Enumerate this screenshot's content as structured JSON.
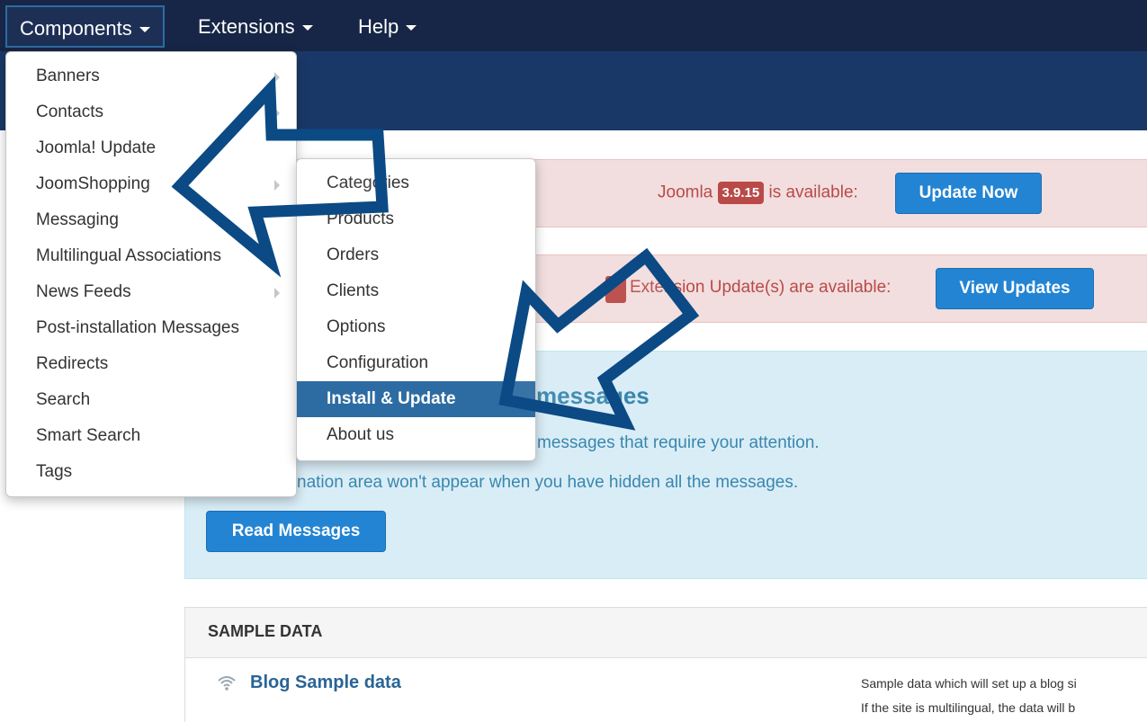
{
  "navbar": {
    "items": [
      {
        "label": "Components"
      },
      {
        "label": "Extensions"
      },
      {
        "label": "Help"
      }
    ]
  },
  "alerts": {
    "joomla_prefix": "Joomla",
    "joomla_version": "3.9.15",
    "joomla_suffix": "is available:",
    "update_now_label": "Update Now",
    "extension_text": "Extension Update(s) are available:",
    "view_updates_label": "View Updates"
  },
  "postinstall": {
    "heading": "messages",
    "line1": "messages that require your attention.",
    "line2": "nation area won't appear when you have hidden all the messages.",
    "read_messages_label": "Read Messages"
  },
  "sample_data": {
    "title": "SAMPLE DATA",
    "blog_label": "Blog Sample data",
    "desc_line1": "Sample data which will set up a blog si",
    "desc_line2": "If the site is multilingual, the data will b"
  },
  "components_menu": {
    "items": [
      {
        "label": "Banners",
        "has_submenu": true
      },
      {
        "label": "Contacts",
        "has_submenu": true
      },
      {
        "label": "Joomla! Update",
        "has_submenu": false
      },
      {
        "label": "JoomShopping",
        "has_submenu": true
      },
      {
        "label": "Messaging",
        "has_submenu": false
      },
      {
        "label": "Multilingual Associations",
        "has_submenu": false
      },
      {
        "label": "News Feeds",
        "has_submenu": true
      },
      {
        "label": "Post-installation Messages",
        "has_submenu": false
      },
      {
        "label": "Redirects",
        "has_submenu": false
      },
      {
        "label": "Search",
        "has_submenu": false
      },
      {
        "label": "Smart Search",
        "has_submenu": false
      },
      {
        "label": "Tags",
        "has_submenu": false
      }
    ]
  },
  "jshop_menu": {
    "items": [
      {
        "label": "Categories"
      },
      {
        "label": "Products"
      },
      {
        "label": "Orders"
      },
      {
        "label": "Clients"
      },
      {
        "label": "Options"
      },
      {
        "label": "Configuration"
      },
      {
        "label": "Install & Update",
        "active": true
      },
      {
        "label": "About us"
      }
    ]
  },
  "colors": {
    "navbar": "#172646",
    "subheader": "#1a3867",
    "accent": "#2d6ca2",
    "button": "#2384d3",
    "alert_bg": "#f2dede",
    "alert_text": "#b94a48",
    "info_bg": "#d9edf7",
    "arrow": "#0b4a84"
  },
  "icons": {
    "blog": "wifi-icon"
  }
}
